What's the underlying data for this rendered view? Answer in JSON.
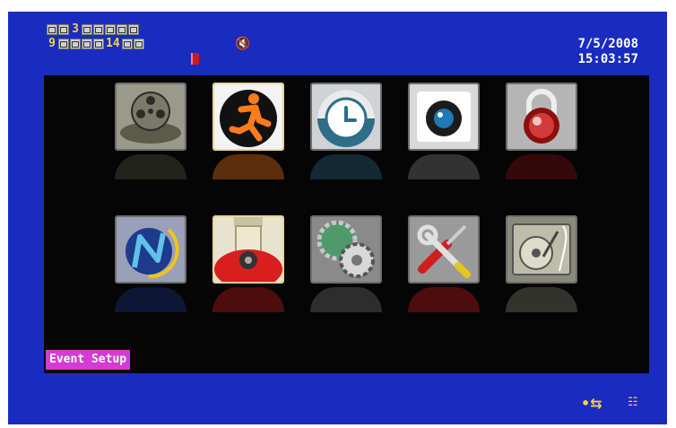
{
  "header": {
    "channels_row1": [
      {
        "label": "",
        "active": false
      },
      {
        "label": "",
        "active": false
      },
      {
        "label": "3",
        "active": true
      },
      {
        "label": "",
        "active": false
      },
      {
        "label": "",
        "active": false
      },
      {
        "label": "",
        "active": false
      },
      {
        "label": "",
        "active": false
      },
      {
        "label": "",
        "active": false
      }
    ],
    "channels_row2": [
      {
        "label": "9",
        "active": true
      },
      {
        "label": "",
        "active": false
      },
      {
        "label": "",
        "active": false
      },
      {
        "label": "",
        "active": false
      },
      {
        "label": "",
        "active": false
      },
      {
        "label": "14",
        "active": true
      },
      {
        "label": "",
        "active": false
      },
      {
        "label": "",
        "active": false
      }
    ],
    "date": "7/5/2008",
    "time": "15:03:57",
    "audio_icon": "muted-speaker-icon",
    "record_icon": "record-indicator-icon"
  },
  "menu": {
    "items": [
      {
        "name": "record-icon",
        "selected": false
      },
      {
        "name": "event-setup-icon",
        "selected": true
      },
      {
        "name": "schedule-icon",
        "selected": false
      },
      {
        "name": "camera-icon",
        "selected": false
      },
      {
        "name": "account-lock-icon",
        "selected": false
      },
      {
        "name": "network-icon",
        "selected": false
      },
      {
        "name": "ptz-camera-icon",
        "selected": true
      },
      {
        "name": "system-gears-icon",
        "selected": false
      },
      {
        "name": "tools-icon",
        "selected": false
      },
      {
        "name": "hdd-icon",
        "selected": false
      }
    ]
  },
  "status": {
    "label": "Event Setup"
  },
  "footer": {
    "usb_icon": "usb-icon",
    "network_icon": "network-status-icon"
  },
  "colors": {
    "background": "#1a2bc0",
    "panel": "#050505",
    "highlight": "#f2d34a",
    "status_label": "#d63ad6"
  }
}
